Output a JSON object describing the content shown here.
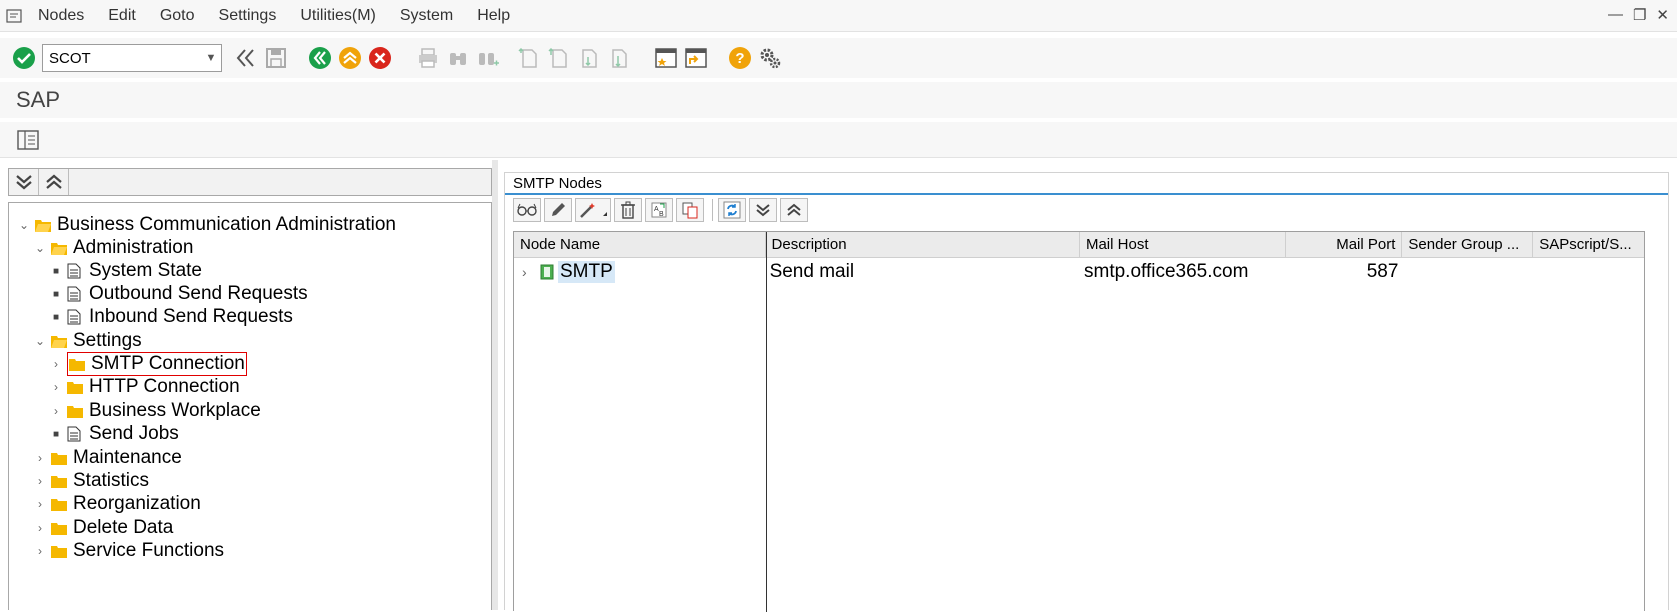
{
  "menu": {
    "items": [
      "Nodes",
      "Edit",
      "Goto",
      "Settings",
      "Utilities(M)",
      "System",
      "Help"
    ]
  },
  "window_controls": [
    "minimize-icon",
    "restore-icon",
    "close-icon"
  ],
  "toolbar": {
    "command_field_value": "SCOT"
  },
  "title": "SAP",
  "tree": {
    "root": "Business Communication Administration",
    "administration": "Administration",
    "system_state": "System State",
    "outbound": "Outbound Send Requests",
    "inbound": "Inbound Send Requests",
    "settings": "Settings",
    "smtp": "SMTP Connection",
    "http": "HTTP Connection",
    "workplace": "Business Workplace",
    "send_jobs": "Send Jobs",
    "maintenance": "Maintenance",
    "statistics": "Statistics",
    "reorganization": "Reorganization",
    "delete_data": "Delete Data",
    "service_functions": "Service Functions"
  },
  "right_panel": {
    "title": "SMTP Nodes",
    "columns": [
      "Node Name",
      "Description",
      "Mail Host",
      "Mail Port",
      "Sender Group ...",
      "SAPscript/S..."
    ],
    "rows": [
      {
        "node": "SMTP",
        "description": "Send mail",
        "host": "smtp.office365.com",
        "port": "587",
        "sender_group": "",
        "sapscript": ""
      }
    ]
  },
  "colors": {
    "accent_blue": "#3a8fd0",
    "folder_yellow": "#f5b800",
    "confirm_green": "#1aa04a",
    "cancel_red": "#d9261c",
    "help_orange": "#f0a30a",
    "selection_red": "#e00000"
  }
}
